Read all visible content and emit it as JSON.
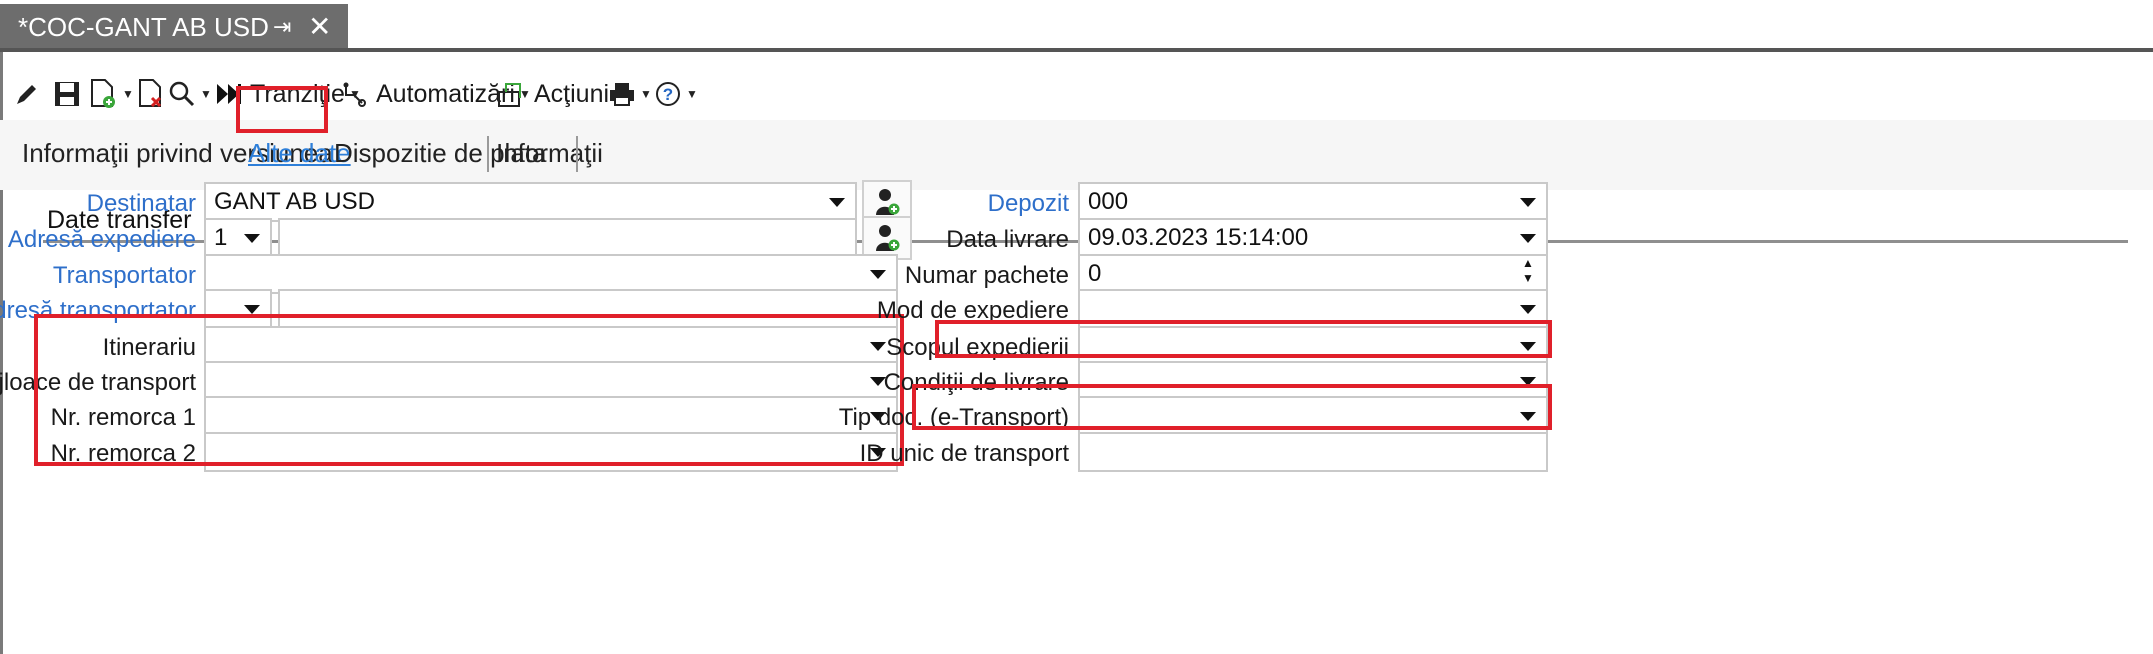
{
  "tab": {
    "title": "*COC-GANT AB USD",
    "pin": "⇥",
    "close": "✕"
  },
  "toolbar": {
    "tranzitie": "Tranziţie",
    "automatizari": "Automatizări",
    "actiuni": "Acţiuni"
  },
  "subnav": {
    "informatii_versiune": "Informaţii privind versiunea",
    "alte_date": "Alte date",
    "dispozitie": "Dispozitie de plata",
    "informatii": "Informaţii"
  },
  "section": {
    "title": "Date transfer"
  },
  "left": {
    "destinatar": {
      "label": "Destinatar",
      "value": "GANT AB USD"
    },
    "adresa_expediere": {
      "label": "Adresă expediere",
      "value": "1",
      "extra": ""
    },
    "transportator": {
      "label": "Transportator",
      "value": ""
    },
    "adresa_transportator": {
      "label": "Adresă transportator",
      "value": "",
      "extra": ""
    },
    "itinerariu": {
      "label": "Itinerariu",
      "value": ""
    },
    "mijloace": {
      "label": "Mijloace de transport",
      "value": ""
    },
    "remorca1": {
      "label": "Nr. remorca 1",
      "value": ""
    },
    "remorca2": {
      "label": "Nr. remorca 2",
      "value": ""
    }
  },
  "right": {
    "depozit": {
      "label": "Depozit",
      "value": "000"
    },
    "data_livrare": {
      "label": "Data livrare",
      "value": "09.03.2023 15:14:00"
    },
    "numar_pachete": {
      "label": "Numar pachete",
      "value": "0"
    },
    "mod_expediere": {
      "label": "Mod de expediere",
      "value": ""
    },
    "scopul": {
      "label": "Scopul expedierii",
      "value": ""
    },
    "conditii": {
      "label": "Condiţii de livrare",
      "value": ""
    },
    "tip_doc": {
      "label": "Tip doc. (e-Transport)",
      "value": ""
    },
    "id_unic": {
      "label": "ID unic de transport",
      "value": ""
    }
  },
  "colors": {
    "highlight": "#e0202a",
    "link": "#2e7fd9",
    "tab_bg": "#6d6d6d"
  },
  "icons": [
    "pencil-icon",
    "save-icon",
    "new-document-icon",
    "delete-document-icon",
    "search-icon",
    "fast-forward-icon",
    "transition-icon",
    "automation-icon",
    "actions-icon",
    "print-icon",
    "help-icon",
    "add-user-icon"
  ]
}
